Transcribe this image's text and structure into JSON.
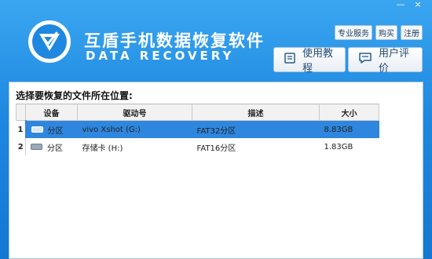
{
  "app": {
    "title_cn": "互盾手机数据恢复软件",
    "title_en": "DATA RECOVERY"
  },
  "window_controls": {
    "minimize": "—",
    "close": "×"
  },
  "top_links": [
    "专业服务",
    "购买",
    "注册"
  ],
  "buttons": {
    "guide_label": "使用教程",
    "review_label": "用户评价"
  },
  "panel": {
    "label": "选择要恢复的文件所在位置:",
    "columns": [
      "设备",
      "驱动号",
      "描述",
      "大小"
    ],
    "rows": [
      {
        "index": "1",
        "type": "分区",
        "drive": "vivo Xshot (G:)",
        "desc": "FAT32分区",
        "size": "8.83GB",
        "selected": true
      },
      {
        "index": "2",
        "type": "分区",
        "drive": "存储卡 (H:)",
        "desc": "FAT16分区",
        "size": "1.83GB",
        "selected": false
      }
    ]
  },
  "colors": {
    "header_top": "#3aa6f0",
    "header_bottom": "#1477d2",
    "selection": "#2e86de"
  }
}
